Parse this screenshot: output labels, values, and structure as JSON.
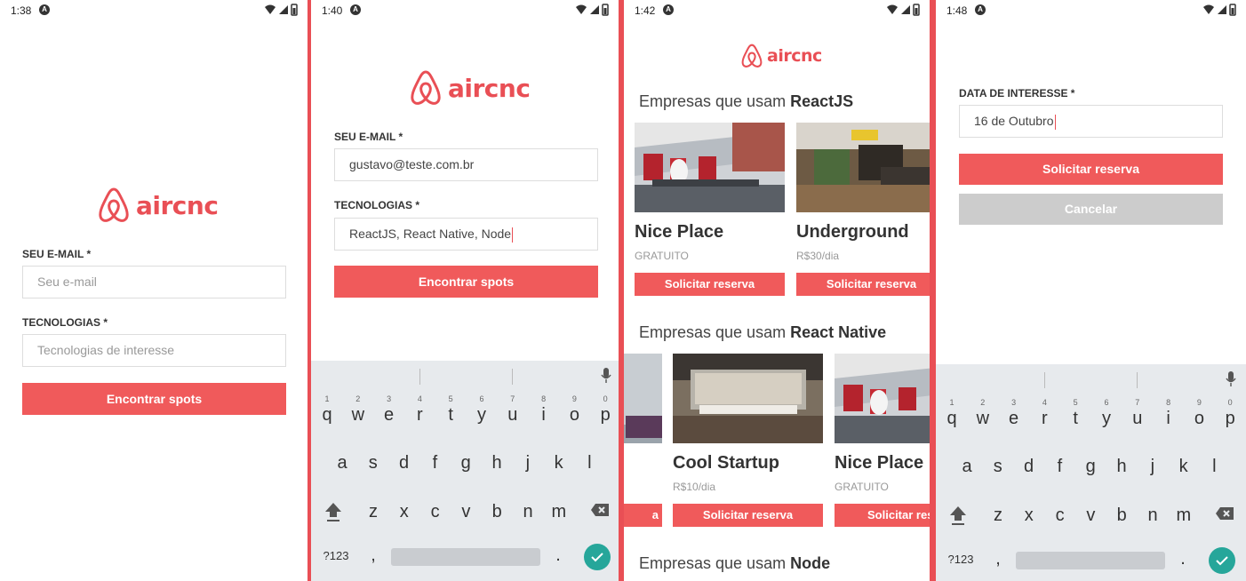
{
  "colors": {
    "accent": "#f05a5b",
    "brand": "#e94f55",
    "cancel": "#cccccc",
    "enter": "#26a69a"
  },
  "brand": "aircnc",
  "keyboard": {
    "row1": [
      "q",
      "w",
      "e",
      "r",
      "t",
      "y",
      "u",
      "i",
      "o",
      "p"
    ],
    "row1_hints": [
      "1",
      "2",
      "3",
      "4",
      "5",
      "6",
      "7",
      "8",
      "9",
      "0"
    ],
    "row2": [
      "a",
      "s",
      "d",
      "f",
      "g",
      "h",
      "j",
      "k",
      "l"
    ],
    "row3": [
      "z",
      "x",
      "c",
      "v",
      "b",
      "n",
      "m"
    ],
    "sym_label": "?123",
    "comma": ",",
    "period": "."
  },
  "screen1": {
    "time": "1:38",
    "email_label": "SEU E-MAIL *",
    "email_placeholder": "Seu e-mail",
    "tech_label": "TECNOLOGIAS *",
    "tech_placeholder": "Tecnologias de interesse",
    "submit": "Encontrar spots"
  },
  "screen2": {
    "time": "1:40",
    "email_label": "SEU E-MAIL *",
    "email_value": "gustavo@teste.com.br",
    "tech_label": "TECNOLOGIAS *",
    "tech_value": "ReactJS, React Native, Node",
    "submit": "Encontrar spots"
  },
  "screen3": {
    "time": "1:42",
    "section_prefix": "Empresas que usam",
    "sections": [
      {
        "tech": "ReactJS",
        "spots": [
          {
            "name": "Nice Place",
            "price": "GRATUITO",
            "button": "Solicitar reserva"
          },
          {
            "name": "Underground",
            "price": "R$30/dia",
            "button": "Solicitar reserva"
          }
        ]
      },
      {
        "tech": "React Native",
        "partial_button": "a",
        "spots": [
          {
            "name": "Cool Startup",
            "price": "R$10/dia",
            "button": "Solicitar reserva"
          },
          {
            "name": "Nice Place",
            "price": "GRATUITO",
            "button": "Solicitar res"
          }
        ]
      },
      {
        "tech": "Node"
      }
    ]
  },
  "screen4": {
    "time": "1:48",
    "date_label": "DATA DE INTERESSE *",
    "date_value": "16 de Outubro",
    "submit": "Solicitar reserva",
    "cancel": "Cancelar"
  }
}
